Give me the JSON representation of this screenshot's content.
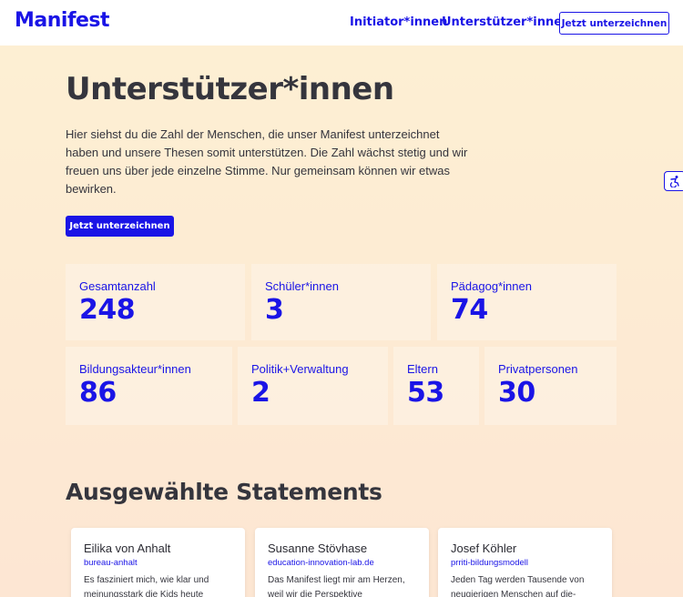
{
  "header": {
    "logo": "Manifest",
    "nav": [
      "Initiator*innen",
      "Unterstützer*innen"
    ],
    "cta_label": "Jetzt unterzeichnen"
  },
  "main": {
    "title": "Unterstützer*innen",
    "intro": "Hier siehst du die Zahl der Menschen, die unser Manifest unterzeichnet haben und unsere Thesen somit unterstützen. Die Zahl wächst stetig und wir freuen uns über jede einzelne Stimme. Nur gemeinsam können wir etwas bewirken.",
    "cta_label": "Jetzt unterzeichnen",
    "accessibility_icon": "accessibility-icon"
  },
  "stats": [
    {
      "label": "Gesamtanzahl",
      "value": "248"
    },
    {
      "label": "Schüler*innen",
      "value": "3"
    },
    {
      "label": "Pädagog*innen",
      "value": "74"
    },
    {
      "label": "Bildungsakteur*innen",
      "value": "86"
    },
    {
      "label": "Politik+Verwaltung",
      "value": "2"
    },
    {
      "label": "Eltern",
      "value": "53"
    },
    {
      "label": "Privatpersonen",
      "value": "30"
    }
  ],
  "statements": {
    "title": "Ausgewählte Statements",
    "cards": [
      {
        "name": "Eilika von Anhalt",
        "org": "bureau-anhalt",
        "text": "Es fasziniert mich, wie klar und meinungsstark die Kids heute"
      },
      {
        "name": "Susanne Stövhase",
        "org": "education-innovation-lab.de",
        "text": "Das Manifest liegt mir am Herzen, weil wir die Perspektive"
      },
      {
        "name": "Josef Köhler",
        "org": "prriti-bildungsmodell",
        "text": "Jeden Tag werden Tausende von neugierigen Menschen auf die-"
      }
    ]
  },
  "colors": {
    "accent": "#1a14e6",
    "text": "#35353d",
    "bg_top": "#fdf0d3",
    "bg_bottom": "#fde6d3"
  }
}
